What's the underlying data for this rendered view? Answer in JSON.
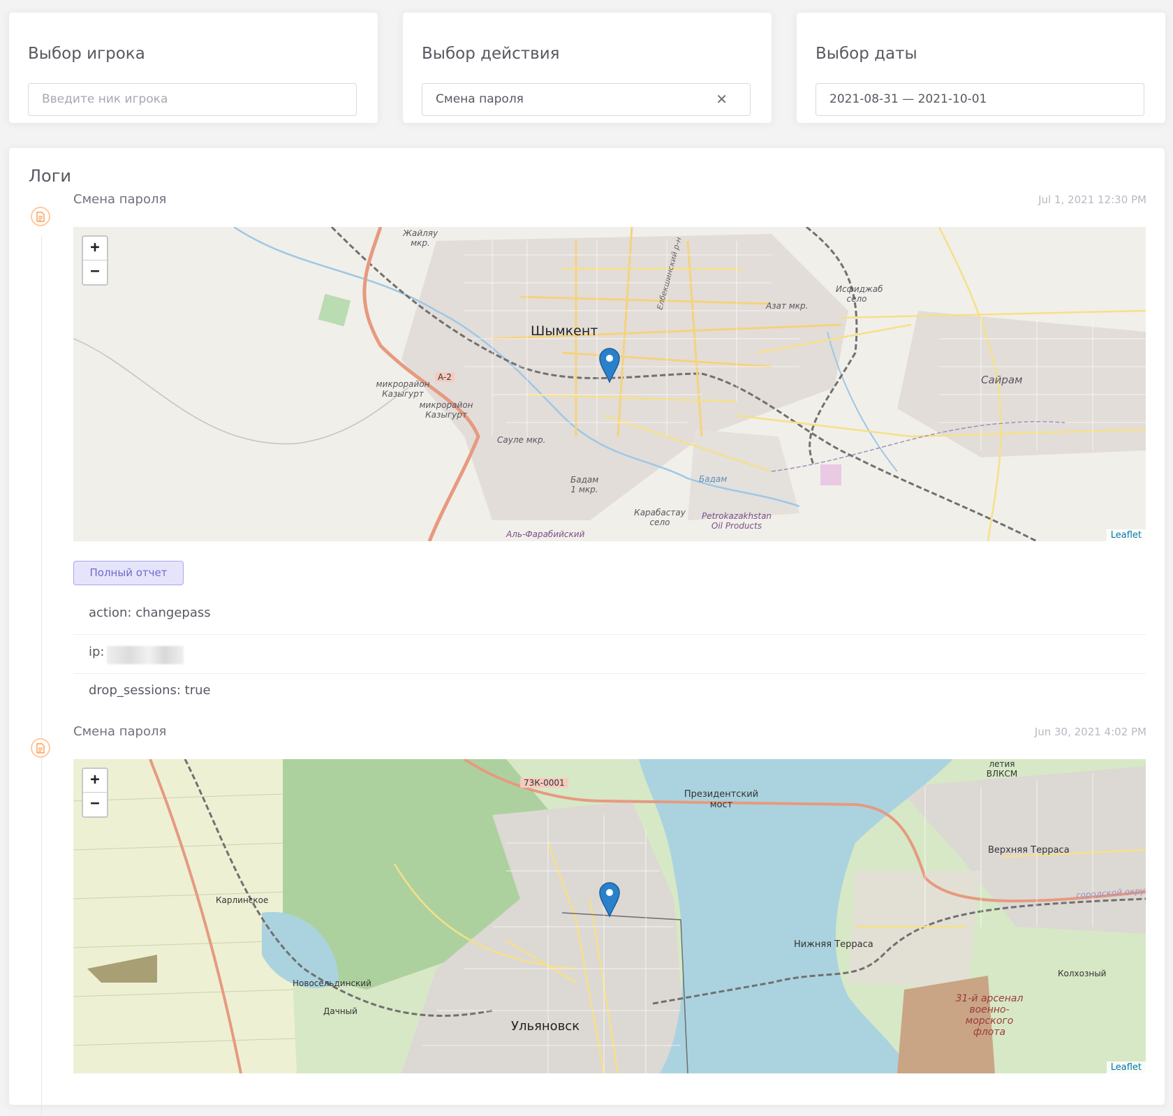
{
  "filters": {
    "player": {
      "title": "Выбор игрока",
      "placeholder": "Введите ник игрока"
    },
    "action": {
      "title": "Выбор действия",
      "value": "Смена пароля",
      "clear_icon": "close-icon"
    },
    "date": {
      "title": "Выбор даты",
      "value": "2021-08-31 — 2021-10-01"
    }
  },
  "logs": {
    "title": "Логи",
    "entries": [
      {
        "title": "Смена пароля",
        "time": "Jul 1, 2021 12:30 PM",
        "map": {
          "zoom_in": "+",
          "zoom_out": "−",
          "attribution": "Leaflet",
          "labels": {
            "city": "Шымкент",
            "l1": "Жайляу мкр.",
            "l2": "Исфиджаб село",
            "l3": "Азат мкр.",
            "l4": "Сайрам",
            "l5": "микрорайон Казыгурт",
            "l6": "микрорайон Казыгурт",
            "l7": "Сауле мкр.",
            "l8": "Бадам 1 мкр.",
            "l9": "Бадам",
            "l10": "Карабастау село",
            "l11": "Petrokazakhstan Oil Products",
            "l12": "Аль-Фарабийский",
            "road": "A-2",
            "street": "Елбекшинский р-н"
          }
        },
        "report_button": "Полный отчет",
        "props": [
          {
            "text": "action: changepass"
          },
          {
            "text": "ip:"
          },
          {
            "text": "drop_sessions: true"
          }
        ]
      },
      {
        "title": "Смена пароля",
        "time": "Jun 30, 2021 4:02 PM",
        "map": {
          "zoom_in": "+",
          "zoom_out": "−",
          "attribution": "Leaflet",
          "labels": {
            "road": "73К-0001",
            "bridge": "Президентский мост",
            "l1": "летия ВЛКСМ",
            "l2": "Верхняя Терраса",
            "l3": "Карлинское",
            "l4": "Нижняя Терраса",
            "l5": "Колхозный",
            "l6": "Новосельдинский",
            "l7": "Дачный",
            "city": "Ульяновск",
            "l8": "31-й арсенал военно-морского флота",
            "l9": "городской округ Ульяновск"
          }
        }
      }
    ]
  }
}
